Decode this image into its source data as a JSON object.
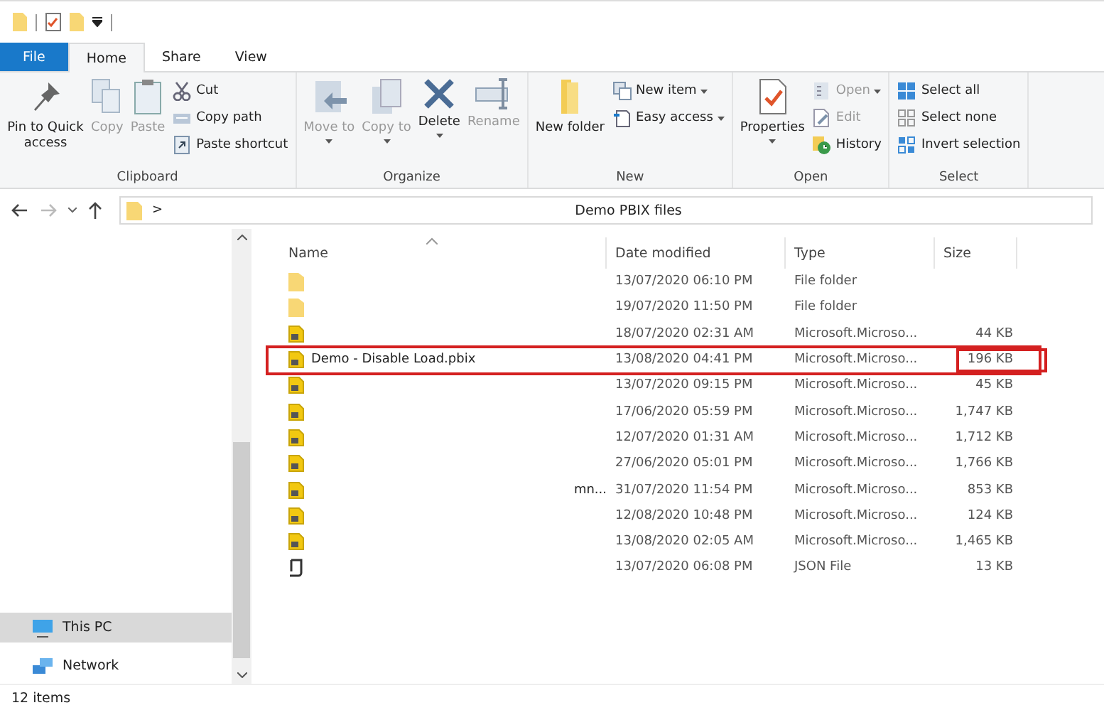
{
  "tabs": [
    {
      "label": "File",
      "kind": "file",
      "selected": false
    },
    {
      "label": "Home",
      "kind": "tab",
      "selected": true
    },
    {
      "label": "Share",
      "kind": "tab",
      "selected": false
    },
    {
      "label": "View",
      "kind": "tab",
      "selected": false
    }
  ],
  "ribbon": [
    {
      "title": "Clipboard",
      "items": [
        {
          "kind": "large",
          "label": "Pin to Quick access",
          "disabled": false
        },
        {
          "kind": "large",
          "label": "Copy",
          "disabled": true
        },
        {
          "kind": "large",
          "label": "Paste",
          "disabled": true
        },
        {
          "kind": "stack",
          "items": [
            {
              "label": "Cut",
              "disabled": false
            },
            {
              "label": "Copy path",
              "disabled": false
            },
            {
              "label": "Paste shortcut",
              "disabled": false
            }
          ]
        }
      ]
    },
    {
      "title": "Organize",
      "items": [
        {
          "kind": "large",
          "label": "Move to",
          "disabled": true,
          "caret": true
        },
        {
          "kind": "large",
          "label": "Copy to",
          "disabled": true,
          "caret": true
        },
        {
          "kind": "large",
          "label": "Delete",
          "disabled": false,
          "caret": true
        },
        {
          "kind": "large",
          "label": "Rename",
          "disabled": true
        }
      ]
    },
    {
      "title": "New",
      "items": [
        {
          "kind": "large",
          "label": "New folder",
          "disabled": false
        },
        {
          "kind": "stack",
          "items": [
            {
              "label": "New item",
              "disabled": false,
              "caret": true
            },
            {
              "label": "Easy access",
              "disabled": false,
              "caret": true
            }
          ]
        }
      ]
    },
    {
      "title": "Open",
      "items": [
        {
          "kind": "large",
          "label": "Properties",
          "disabled": false,
          "caret": true
        },
        {
          "kind": "stack",
          "items": [
            {
              "label": "Open",
              "disabled": true,
              "caret": true
            },
            {
              "label": "Edit",
              "disabled": true
            },
            {
              "label": "History",
              "disabled": false
            }
          ]
        }
      ]
    },
    {
      "title": "Select",
      "items": [
        {
          "kind": "stack",
          "items": [
            {
              "label": "Select all",
              "disabled": false
            },
            {
              "label": "Select none",
              "disabled": false
            },
            {
              "label": "Invert selection",
              "disabled": false
            }
          ]
        }
      ]
    }
  ],
  "address": {
    "separator": ">",
    "path": "Demo PBIX files"
  },
  "nav": [
    {
      "label": "This PC",
      "selected": true
    },
    {
      "label": "Network",
      "selected": false
    }
  ],
  "columns": [
    "Name",
    "Date modified",
    "Type",
    "Size"
  ],
  "rows": [
    {
      "kind": "folder",
      "date": "13/07/2020 06:10 PM",
      "type": "File folder",
      "highlighted": false
    },
    {
      "kind": "folder",
      "date": "19/07/2020 11:50 PM",
      "type": "File folder",
      "highlighted": false
    },
    {
      "kind": "pbix",
      "date": "18/07/2020 02:31 AM",
      "type": "Microsoft.Microso...",
      "size": "44 KB",
      "highlighted": false
    },
    {
      "kind": "pbix",
      "name": "Demo - Disable Load.pbix",
      "date": "13/08/2020 04:41 PM",
      "type": "Microsoft.Microso...",
      "size": "196 KB",
      "highlighted": true
    },
    {
      "kind": "pbix",
      "date": "13/07/2020 09:15 PM",
      "type": "Microsoft.Microso...",
      "size": "45 KB",
      "highlighted": false
    },
    {
      "kind": "pbix",
      "date": "17/06/2020 05:59 PM",
      "type": "Microsoft.Microso...",
      "size": "1,747 KB",
      "highlighted": false
    },
    {
      "kind": "pbix",
      "date": "12/07/2020 01:31 AM",
      "type": "Microsoft.Microso...",
      "size": "1,712 KB",
      "highlighted": false
    },
    {
      "kind": "pbix",
      "date": "27/06/2020 05:01 PM",
      "type": "Microsoft.Microso...",
      "size": "1,766 KB",
      "highlighted": false
    },
    {
      "kind": "pbix",
      "name_tail": "mn...",
      "date": "31/07/2020 11:54 PM",
      "type": "Microsoft.Microso...",
      "size": "853 KB",
      "highlighted": false
    },
    {
      "kind": "pbix",
      "date": "12/08/2020 10:48 PM",
      "type": "Microsoft.Microso...",
      "size": "124 KB",
      "highlighted": false
    },
    {
      "kind": "pbix",
      "date": "13/08/2020 02:05 AM",
      "type": "Microsoft.Microso...",
      "size": "1,465 KB",
      "highlighted": false
    },
    {
      "kind": "json",
      "date": "13/07/2020 06:08 PM",
      "type": "JSON File",
      "size": "13 KB",
      "highlighted": false
    }
  ],
  "status_bar": "12 items"
}
